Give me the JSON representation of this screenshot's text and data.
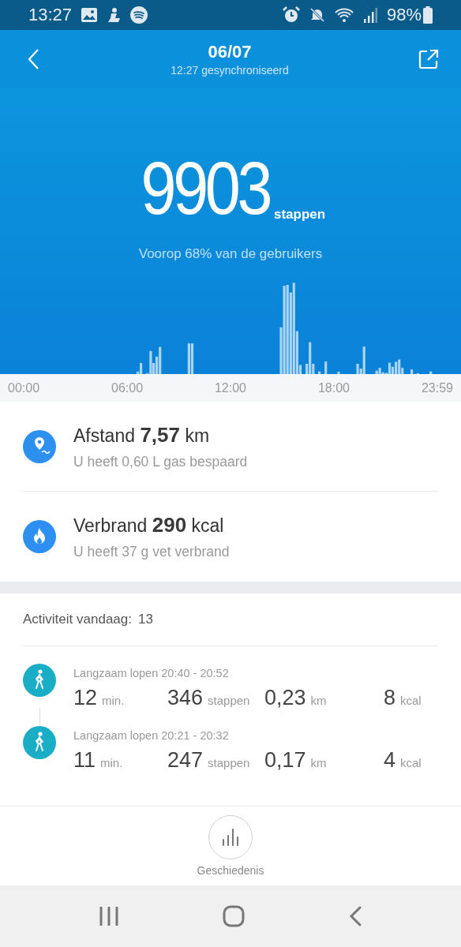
{
  "status_bar": {
    "time": "13:27",
    "battery": "98%"
  },
  "header": {
    "title": "06/07",
    "subtitle": "12:27 gesynchroniseerd"
  },
  "summary": {
    "steps": "9903",
    "unit": "stappen",
    "comparison": "Voorop 68% van de gebruikers"
  },
  "chart": {
    "axis_labels": [
      "00:00",
      "06:00",
      "12:00",
      "18:00",
      "23:59"
    ]
  },
  "stats": [
    {
      "kind": "distance",
      "label": "Afstand",
      "value": "7,57",
      "unit": "km",
      "detail": "U heeft 0,60 L gas bespaard"
    },
    {
      "kind": "calories",
      "label": "Verbrand",
      "value": "290",
      "unit": "kcal",
      "detail": "U heeft 37 g vet verbrand"
    }
  ],
  "activity": {
    "label": "Activiteit vandaag:",
    "count": "13",
    "items": [
      {
        "title": "Langzaam lopen 20:40 - 20:52",
        "stats": [
          {
            "value": "12",
            "unit": "min."
          },
          {
            "value": "346",
            "unit": "stappen"
          },
          {
            "value": "0,23",
            "unit": "km"
          },
          {
            "value": "8",
            "unit": "kcal"
          }
        ]
      },
      {
        "title": "Langzaam lopen 20:21 - 20:32",
        "stats": [
          {
            "value": "11",
            "unit": "min."
          },
          {
            "value": "247",
            "unit": "stappen"
          },
          {
            "value": "0,17",
            "unit": "km"
          },
          {
            "value": "4",
            "unit": "kcal"
          }
        ]
      }
    ]
  },
  "bottom_bar": {
    "history_button": "Geschiedenis"
  }
}
